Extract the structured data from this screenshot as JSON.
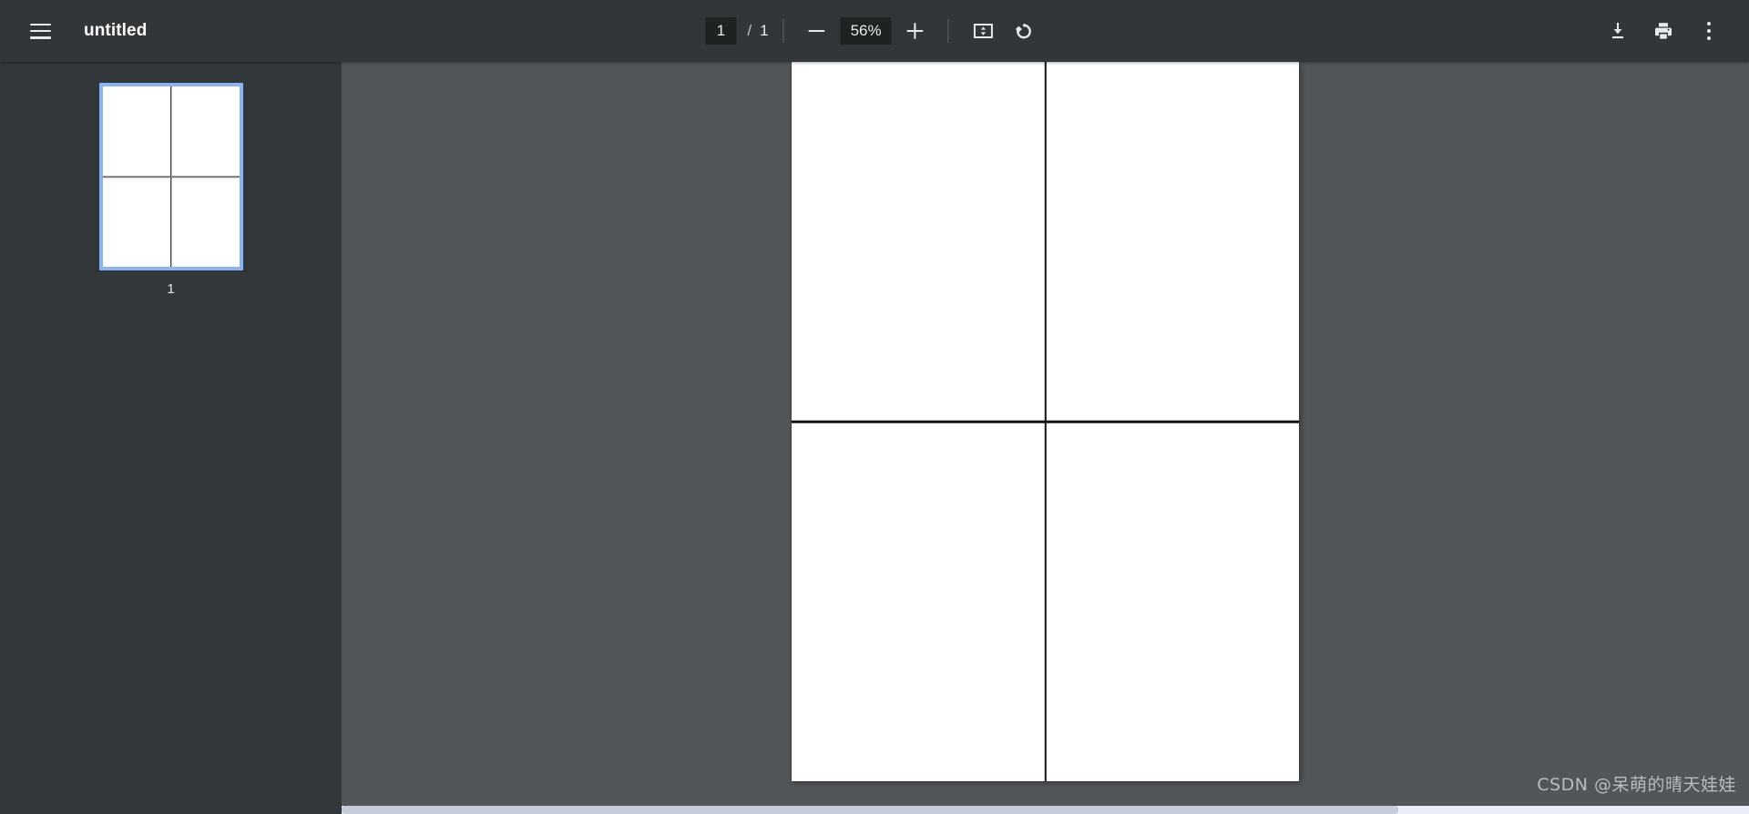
{
  "toolbar": {
    "menu_icon": "hamburger-menu-icon",
    "title": "untitled",
    "page_current": "1",
    "page_separator": "/",
    "page_total": "1",
    "zoom_out_icon": "minus-icon",
    "zoom_level": "56%",
    "zoom_in_icon": "plus-icon",
    "fit_page_icon": "fit-to-page-icon",
    "rotate_icon": "rotate-counterclockwise-icon",
    "download_icon": "download-icon",
    "print_icon": "print-icon",
    "more_icon": "more-options-kebab-icon"
  },
  "sidebar": {
    "thumbnails": [
      {
        "label": "1",
        "selected": true
      }
    ]
  },
  "viewer": {
    "document_page": "page-1-preview",
    "background_color": "#525659"
  },
  "watermark": {
    "text": "CSDN @呆萌的晴天娃娃"
  },
  "colors": {
    "toolbar_bg": "#323639",
    "sidebar_bg": "#32373a",
    "viewer_bg": "#525659",
    "selection_blue": "#8ab4f8",
    "field_bg": "#1f2223",
    "text_light": "#e8eaed"
  }
}
